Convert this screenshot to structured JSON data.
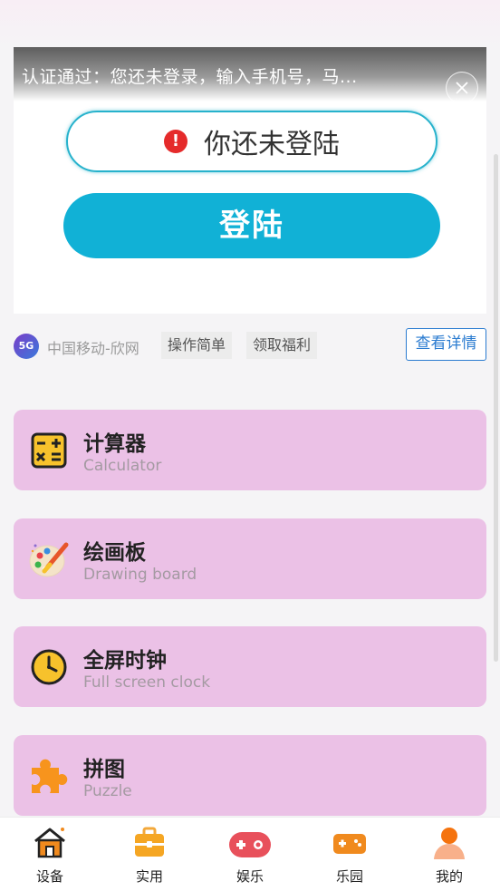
{
  "ad": {
    "header_text": "认证通过：您还未登录，输入手机号，马...",
    "input_text": "你还未登陆",
    "login_label": "登陆",
    "brand_name": "中国移动-欣网",
    "brand_logo": "5G",
    "tags": [
      "操作简单",
      "领取福利"
    ],
    "detail_label": "查看详情"
  },
  "tools": [
    {
      "title": "计算器",
      "subtitle": "Calculator",
      "icon": "calculator-icon"
    },
    {
      "title": "绘画板",
      "subtitle": "Drawing board",
      "icon": "palette-icon"
    },
    {
      "title": "全屏时钟",
      "subtitle": "Full screen clock",
      "icon": "clock-icon"
    },
    {
      "title": "拼图",
      "subtitle": "Puzzle",
      "icon": "puzzle-icon"
    }
  ],
  "nav": [
    {
      "label": "设备",
      "icon": "house-icon"
    },
    {
      "label": "实用",
      "icon": "toolbox-icon"
    },
    {
      "label": "娱乐",
      "icon": "gamepad-icon"
    },
    {
      "label": "乐园",
      "icon": "game-console-icon"
    },
    {
      "label": "我的",
      "icon": "user-icon"
    }
  ],
  "colors": {
    "card_bg": "#ebc1e6",
    "accent": "#11b1d6",
    "link": "#2a7bd0",
    "nav_orange": "#f08a1e",
    "nav_red": "#e8505b"
  }
}
